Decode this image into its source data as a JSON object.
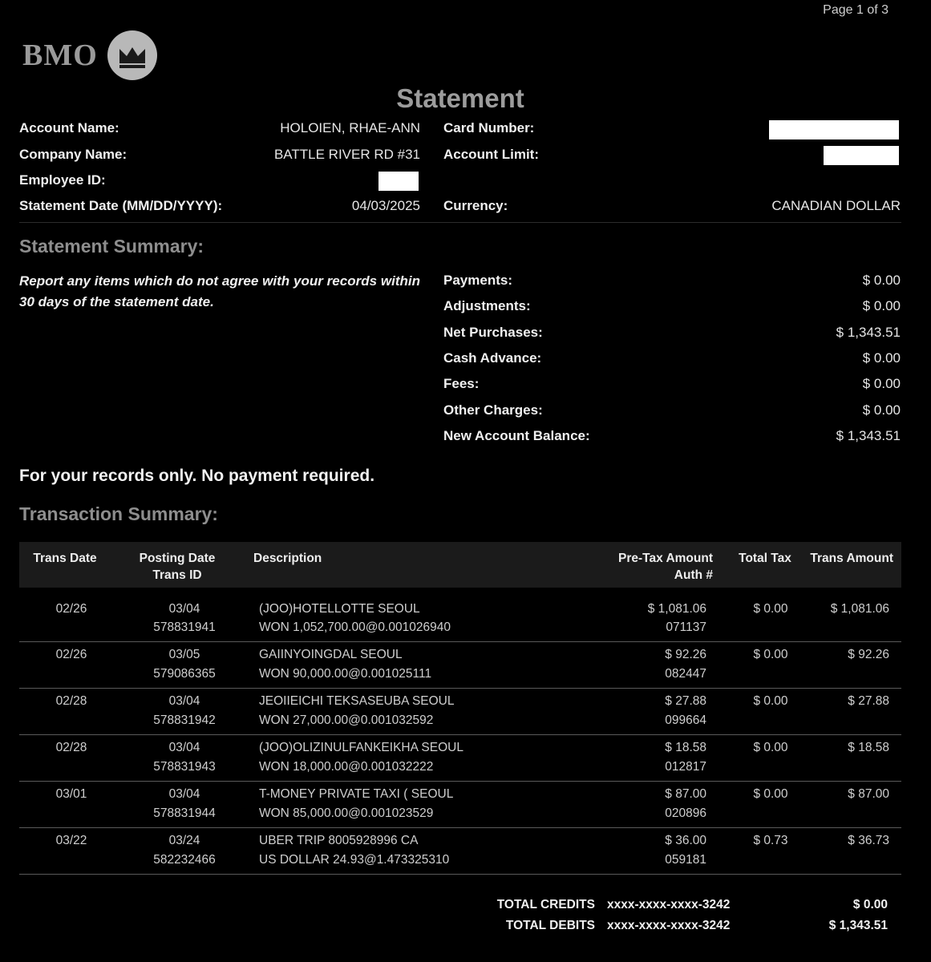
{
  "page": {
    "label": "Page 1 of 3"
  },
  "logo": {
    "text": "BMO"
  },
  "title": "Statement",
  "account": {
    "account_name_label": "Account Name:",
    "account_name": "HOLOIEN, RHAE-ANN",
    "company_name_label": "Company Name:",
    "company_name": "BATTLE RIVER RD #31",
    "employee_id_label": "Employee ID:",
    "statement_date_label": "Statement Date (MM/DD/YYYY):",
    "statement_date": "04/03/2025",
    "card_number_label": "Card Number:",
    "account_limit_label": "Account Limit:",
    "currency_label": "Currency:",
    "currency": "CANADIAN DOLLAR"
  },
  "summary": {
    "heading": "Statement Summary:",
    "note": "Report any items which do not agree with your records within 30 days of the statement date.",
    "items": [
      {
        "label": "Payments:",
        "value": "$ 0.00"
      },
      {
        "label": "Adjustments:",
        "value": "$ 0.00"
      },
      {
        "label": "Net Purchases:",
        "value": "$ 1,343.51"
      },
      {
        "label": "Cash Advance:",
        "value": "$ 0.00"
      },
      {
        "label": "Fees:",
        "value": "$ 0.00"
      },
      {
        "label": "Other Charges:",
        "value": "$ 0.00"
      },
      {
        "label": "New Account Balance:",
        "value": "$ 1,343.51"
      }
    ]
  },
  "records_note": "For your records only. No payment required.",
  "transactions": {
    "heading": "Transaction Summary:",
    "headers": {
      "trans_date": "Trans Date",
      "posting_date": "Posting Date",
      "trans_id": "Trans ID",
      "description": "Description",
      "pretax": "Pre-Tax Amount",
      "auth": "Auth #",
      "total_tax": "Total Tax",
      "trans_amount": "Trans Amount"
    },
    "rows": [
      {
        "trans_date": "02/26",
        "posting_date": "03/04",
        "trans_id": "578831941",
        "desc1": "(JOO)HOTELLOTTE SEOUL",
        "desc2": "WON 1,052,700.00@0.001026940",
        "pretax": "$ 1,081.06",
        "auth": "071137",
        "tax": "$ 0.00",
        "amount": "$ 1,081.06"
      },
      {
        "trans_date": "02/26",
        "posting_date": "03/05",
        "trans_id": "579086365",
        "desc1": "GAIINYOINGDAL SEOUL",
        "desc2": "WON 90,000.00@0.001025111",
        "pretax": "$ 92.26",
        "auth": "082447",
        "tax": "$ 0.00",
        "amount": "$ 92.26"
      },
      {
        "trans_date": "02/28",
        "posting_date": "03/04",
        "trans_id": "578831942",
        "desc1": "JEOIIEICHI TEKSASEUBA SEOUL",
        "desc2": "WON 27,000.00@0.001032592",
        "pretax": "$ 27.88",
        "auth": "099664",
        "tax": "$ 0.00",
        "amount": "$ 27.88"
      },
      {
        "trans_date": "02/28",
        "posting_date": "03/04",
        "trans_id": "578831943",
        "desc1": "(JOO)OLIZINULFANKEIKHA SEOUL",
        "desc2": "WON 18,000.00@0.001032222",
        "pretax": "$ 18.58",
        "auth": "012817",
        "tax": "$ 0.00",
        "amount": "$ 18.58"
      },
      {
        "trans_date": "03/01",
        "posting_date": "03/04",
        "trans_id": "578831944",
        "desc1": "T-MONEY PRIVATE TAXI ( SEOUL",
        "desc2": "WON 85,000.00@0.001023529",
        "pretax": "$ 87.00",
        "auth": "020896",
        "tax": "$ 0.00",
        "amount": "$ 87.00"
      },
      {
        "trans_date": "03/22",
        "posting_date": "03/24",
        "trans_id": "582232466",
        "desc1": "UBER TRIP 8005928996 CA",
        "desc2": "US DOLLAR 24.93@1.473325310",
        "pretax": "$ 36.00",
        "auth": "059181",
        "tax": "$ 0.73",
        "amount": "$ 36.73"
      }
    ]
  },
  "totals": {
    "credits_label": "TOTAL CREDITS",
    "credits_card": "xxxx-xxxx-xxxx-3242",
    "credits_value": "$ 0.00",
    "debits_label": "TOTAL DEBITS",
    "debits_card": "xxxx-xxxx-xxxx-3242",
    "debits_value": "$ 1,343.51"
  }
}
